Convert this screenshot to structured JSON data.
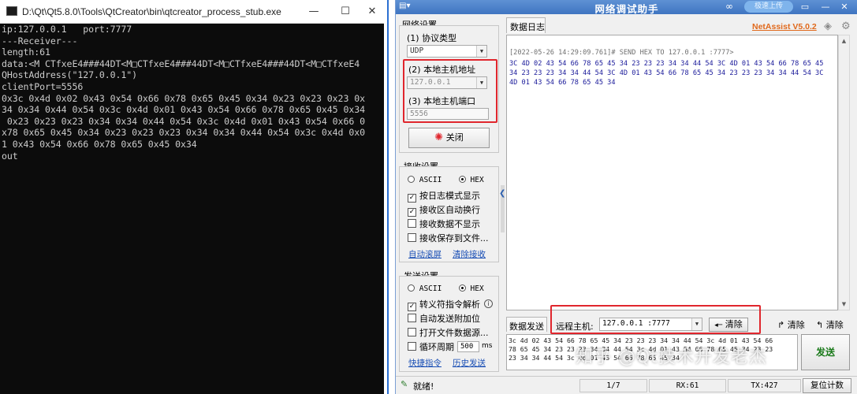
{
  "console": {
    "title": "D:\\Qt\\Qt5.8.0\\Tools\\QtCreator\\bin\\qtcreator_process_stub.exe",
    "minimize": "—",
    "maximize": "☐",
    "close": "✕",
    "lines": [
      "ip:127.0.0.1   port:7777",
      "---Receiver---",
      "length:61",
      "data:<M CTfxeE4###44DT<M□CTfxeE4###44DT<M□CTfxeE4###44DT<M□CTfxeE4",
      "QHostAddress(\"127.0.0.1\")",
      "clientPort=5556",
      "0x3c 0x4d 0x02 0x43 0x54 0x66 0x78 0x65 0x45 0x34 0x23 0x23 0x23 0x",
      "34 0x34 0x44 0x54 0x3c 0x4d 0x01 0x43 0x54 0x66 0x78 0x65 0x45 0x34",
      " 0x23 0x23 0x23 0x34 0x34 0x44 0x54 0x3c 0x4d 0x01 0x43 0x54 0x66 0",
      "x78 0x65 0x45 0x34 0x23 0x23 0x23 0x34 0x34 0x44 0x54 0x3c 0x4d 0x0",
      "1 0x43 0x54 0x66 0x78 0x65 0x45 0x34",
      "out"
    ]
  },
  "netassist": {
    "title": "网络调试助手",
    "upload_label": "极速上传",
    "brand": "NetAssist V5.0.2",
    "network_settings": {
      "group_label": "网络设置",
      "protocol_label": "(1) 协议类型",
      "protocol_value": "UDP",
      "host_label": "(2) 本地主机地址",
      "host_value": "127.0.0.1",
      "port_label": "(3) 本地主机端口",
      "port_value": "5556",
      "close_button": "关闭"
    },
    "receive_settings": {
      "group_label": "接收设置",
      "ascii": "ASCII",
      "hex": "HEX",
      "options": [
        {
          "label": "按日志模式显示",
          "checked": true
        },
        {
          "label": "接收区自动换行",
          "checked": true
        },
        {
          "label": "接收数据不显示",
          "checked": false
        },
        {
          "label": "接收保存到文件...",
          "checked": false
        }
      ],
      "auto_scroll": "自动滚屏",
      "clear_receive": "清除接收"
    },
    "send_settings": {
      "group_label": "发送设置",
      "ascii": "ASCII",
      "hex": "HEX",
      "options": [
        {
          "label": "转义符指令解析",
          "checked": true
        },
        {
          "label": "自动发送附加位",
          "checked": false
        },
        {
          "label": "打开文件数据源...",
          "checked": false
        },
        {
          "label": "循环周期",
          "checked": false
        }
      ],
      "cycle_value": "500",
      "cycle_unit": "ms",
      "shortcut_link": "快捷指令",
      "history_link": "历史发送"
    },
    "log": {
      "tab_label": "数据日志",
      "lines": [
        "[2022-05-26 14:29:09.761]# SEND HEX TO 127.0.0.1 :7777>",
        "3C 4D 02 43 54 66 78 65 45 34 23 23 23 34 34 44 54 3C 4D 01 43 54 66 78 65 45",
        "34 23 23 23 34 34 44 54 3C 4D 01 43 54 66 78 65 45 34 23 23 23 34 34 44 54 3C",
        "4D 01 43 54 66 78 65 45 34"
      ]
    },
    "send": {
      "tab_label": "数据发送",
      "remote_host_label": "远程主机:",
      "remote_host_value": "127.0.0.1 :7777",
      "clear_button": "清除",
      "clear_label_1": "清除",
      "clear_label_2": "清除",
      "send_lines": [
        "3c 4d 02 43 54 66 78 65 45 34 23 23 23 34 34 44 54 3c 4d 01 43 54 66",
        "78 65 45 34 23 23 23 34 34 44 54 3c 4d 01 43 54 66 78 65 45 34 23 23",
        "23 34 34 44 54 3c 4d 01 43 54 66 78 65 45 34"
      ],
      "send_button": "发送"
    },
    "watermark": "知乎 @Qt技术开发老杰",
    "status": {
      "ready": "就绪!",
      "page": "1/7",
      "rx": "RX:61",
      "tx": "TX:427",
      "reset": "复位计数"
    }
  },
  "colors": {
    "highlight_red": "#e0262d",
    "brand_orange": "#e0691c",
    "titlebar_blue": "#3f75c1"
  }
}
